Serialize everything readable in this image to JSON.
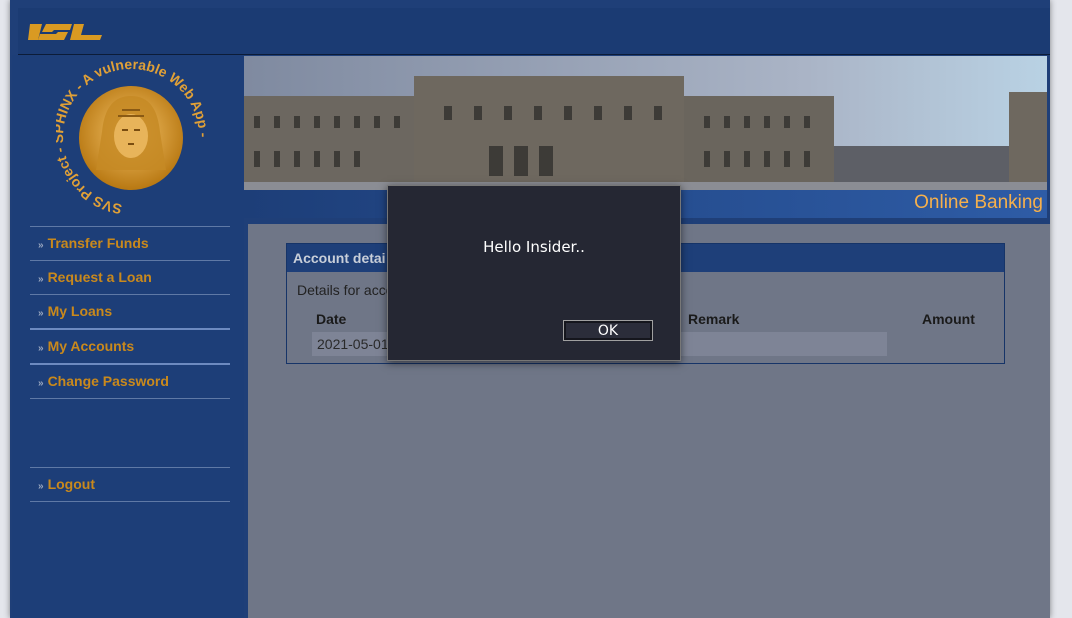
{
  "colors": {
    "header_bg": "#1b3b73",
    "sidebar_bg": "#1d3e78",
    "nav_text": "#c9891c",
    "tagline": "#f6b04c",
    "dialog_bg": "#252733"
  },
  "header": {
    "logo_text": "ISL"
  },
  "emblem": {
    "ring_text": "SVS Project - SPHINX - A vulnerable Web App -"
  },
  "banner": {
    "tagline": "Online Banking"
  },
  "sidebar": {
    "items": [
      {
        "label": "Transfer Funds"
      },
      {
        "label": "Request a Loan"
      },
      {
        "label": "My Loans"
      },
      {
        "label": "My Accounts"
      },
      {
        "label": "Change Password"
      }
    ],
    "logout_label": "Logout",
    "chevron": "»"
  },
  "panel": {
    "title": "Account detai",
    "subtitle": "Details for acco",
    "columns": {
      "date": "Date",
      "remark": "Remark",
      "amount": "Amount"
    },
    "rows": [
      {
        "date": "2021-05-01"
      }
    ]
  },
  "dialog": {
    "message": "Hello Insider..",
    "ok_label": "OK"
  }
}
